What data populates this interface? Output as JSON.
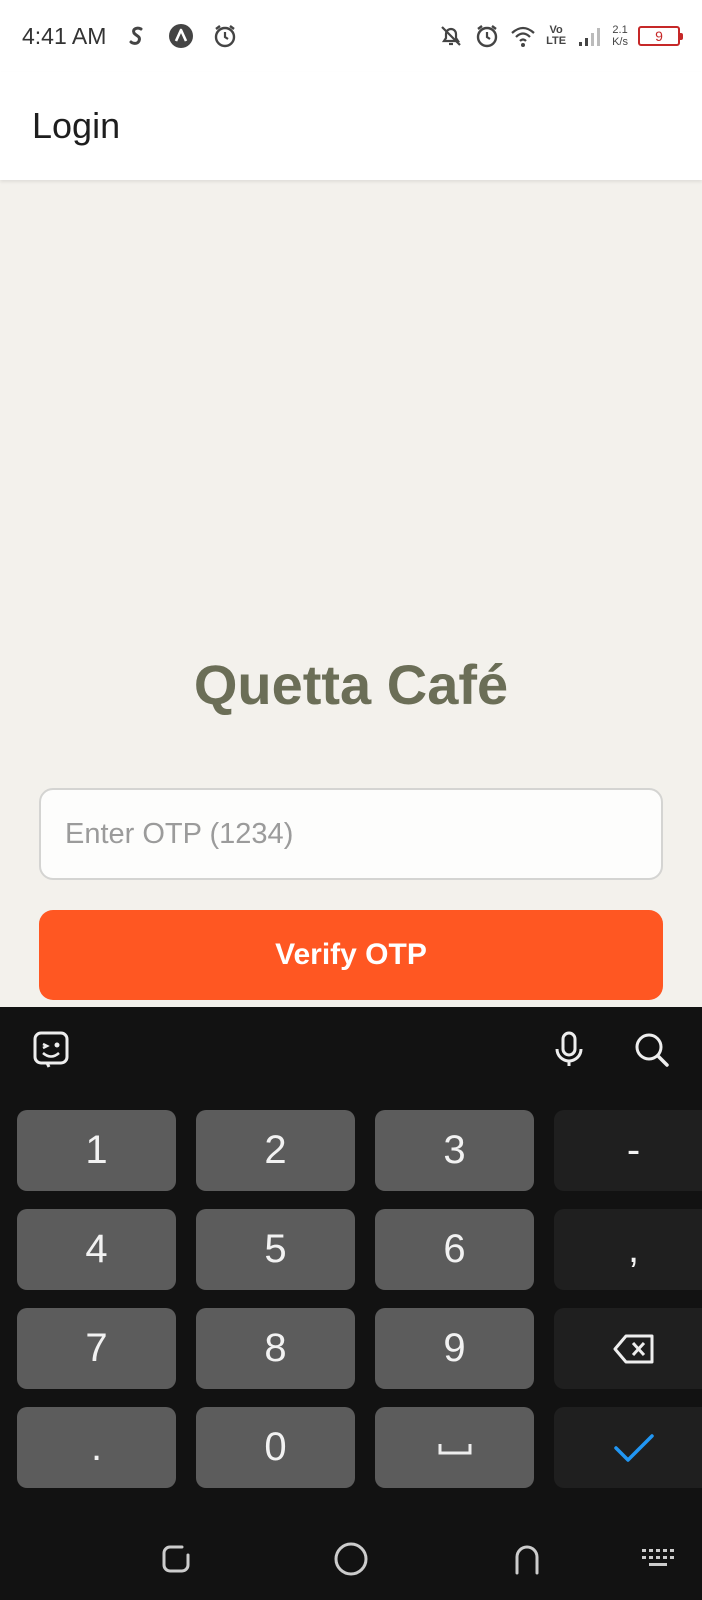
{
  "status_bar": {
    "time": "4:41 AM",
    "volte_top": "Vo",
    "volte_bottom": "LTE",
    "net_speed_value": "2.1",
    "net_speed_unit": "K/s",
    "battery_level": "9",
    "icons": [
      "s-app-icon",
      "a-app-icon",
      "alarm-icon",
      "notifications-off-icon",
      "alarm-icon",
      "wifi-icon",
      "signal-icon",
      "battery-icon"
    ]
  },
  "app_bar": {
    "title": "Login"
  },
  "main": {
    "brand": "Quetta Café",
    "otp_placeholder": "Enter OTP (1234)",
    "otp_value": "",
    "verify_label": "Verify OTP"
  },
  "keyboard": {
    "toolbar_icons": [
      "sticker-icon",
      "microphone-icon",
      "search-icon"
    ],
    "keys": {
      "k1": "1",
      "k2": "2",
      "k3": "3",
      "dash": "-",
      "k4": "4",
      "k5": "5",
      "k6": "6",
      "comma": ",",
      "k7": "7",
      "k8": "8",
      "k9": "9",
      "dot": ".",
      "k0": "0"
    },
    "special_keys": [
      "backspace-icon",
      "space-icon",
      "enter-check-icon"
    ]
  },
  "nav_bar": {
    "icons": [
      "recents-icon",
      "home-icon",
      "back-icon",
      "keyboard-switch-icon"
    ]
  },
  "colors": {
    "accent": "#ff5722",
    "brand_text": "#6b6e57",
    "background": "#f3f1ec",
    "keyboard_bg": "#121212",
    "key_bg": "#5c5c5c",
    "key_fn_bg": "#1f1f1f",
    "enter_check": "#2196f3",
    "battery": "#c62828"
  }
}
